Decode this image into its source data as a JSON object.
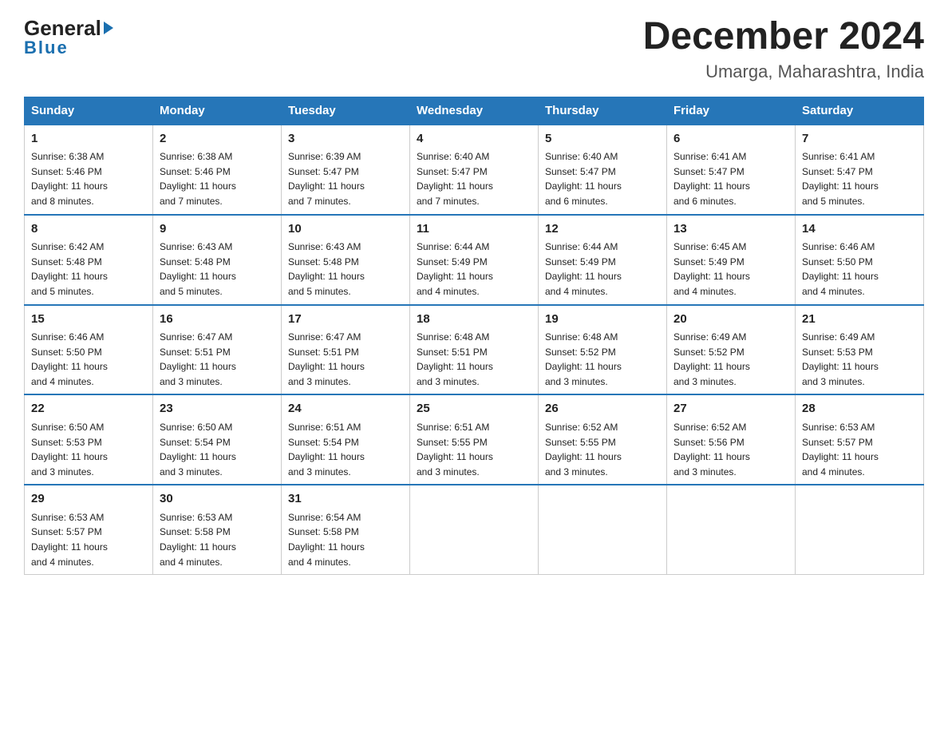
{
  "header": {
    "logo_general": "General",
    "logo_blue": "Blue",
    "month_year": "December 2024",
    "location": "Umarga, Maharashtra, India"
  },
  "weekdays": [
    "Sunday",
    "Monday",
    "Tuesday",
    "Wednesday",
    "Thursday",
    "Friday",
    "Saturday"
  ],
  "weeks": [
    [
      {
        "day": "1",
        "sunrise": "6:38 AM",
        "sunset": "5:46 PM",
        "daylight": "11 hours and 8 minutes."
      },
      {
        "day": "2",
        "sunrise": "6:38 AM",
        "sunset": "5:46 PM",
        "daylight": "11 hours and 7 minutes."
      },
      {
        "day": "3",
        "sunrise": "6:39 AM",
        "sunset": "5:47 PM",
        "daylight": "11 hours and 7 minutes."
      },
      {
        "day": "4",
        "sunrise": "6:40 AM",
        "sunset": "5:47 PM",
        "daylight": "11 hours and 7 minutes."
      },
      {
        "day": "5",
        "sunrise": "6:40 AM",
        "sunset": "5:47 PM",
        "daylight": "11 hours and 6 minutes."
      },
      {
        "day": "6",
        "sunrise": "6:41 AM",
        "sunset": "5:47 PM",
        "daylight": "11 hours and 6 minutes."
      },
      {
        "day": "7",
        "sunrise": "6:41 AM",
        "sunset": "5:47 PM",
        "daylight": "11 hours and 5 minutes."
      }
    ],
    [
      {
        "day": "8",
        "sunrise": "6:42 AM",
        "sunset": "5:48 PM",
        "daylight": "11 hours and 5 minutes."
      },
      {
        "day": "9",
        "sunrise": "6:43 AM",
        "sunset": "5:48 PM",
        "daylight": "11 hours and 5 minutes."
      },
      {
        "day": "10",
        "sunrise": "6:43 AM",
        "sunset": "5:48 PM",
        "daylight": "11 hours and 5 minutes."
      },
      {
        "day": "11",
        "sunrise": "6:44 AM",
        "sunset": "5:49 PM",
        "daylight": "11 hours and 4 minutes."
      },
      {
        "day": "12",
        "sunrise": "6:44 AM",
        "sunset": "5:49 PM",
        "daylight": "11 hours and 4 minutes."
      },
      {
        "day": "13",
        "sunrise": "6:45 AM",
        "sunset": "5:49 PM",
        "daylight": "11 hours and 4 minutes."
      },
      {
        "day": "14",
        "sunrise": "6:46 AM",
        "sunset": "5:50 PM",
        "daylight": "11 hours and 4 minutes."
      }
    ],
    [
      {
        "day": "15",
        "sunrise": "6:46 AM",
        "sunset": "5:50 PM",
        "daylight": "11 hours and 4 minutes."
      },
      {
        "day": "16",
        "sunrise": "6:47 AM",
        "sunset": "5:51 PM",
        "daylight": "11 hours and 3 minutes."
      },
      {
        "day": "17",
        "sunrise": "6:47 AM",
        "sunset": "5:51 PM",
        "daylight": "11 hours and 3 minutes."
      },
      {
        "day": "18",
        "sunrise": "6:48 AM",
        "sunset": "5:51 PM",
        "daylight": "11 hours and 3 minutes."
      },
      {
        "day": "19",
        "sunrise": "6:48 AM",
        "sunset": "5:52 PM",
        "daylight": "11 hours and 3 minutes."
      },
      {
        "day": "20",
        "sunrise": "6:49 AM",
        "sunset": "5:52 PM",
        "daylight": "11 hours and 3 minutes."
      },
      {
        "day": "21",
        "sunrise": "6:49 AM",
        "sunset": "5:53 PM",
        "daylight": "11 hours and 3 minutes."
      }
    ],
    [
      {
        "day": "22",
        "sunrise": "6:50 AM",
        "sunset": "5:53 PM",
        "daylight": "11 hours and 3 minutes."
      },
      {
        "day": "23",
        "sunrise": "6:50 AM",
        "sunset": "5:54 PM",
        "daylight": "11 hours and 3 minutes."
      },
      {
        "day": "24",
        "sunrise": "6:51 AM",
        "sunset": "5:54 PM",
        "daylight": "11 hours and 3 minutes."
      },
      {
        "day": "25",
        "sunrise": "6:51 AM",
        "sunset": "5:55 PM",
        "daylight": "11 hours and 3 minutes."
      },
      {
        "day": "26",
        "sunrise": "6:52 AM",
        "sunset": "5:55 PM",
        "daylight": "11 hours and 3 minutes."
      },
      {
        "day": "27",
        "sunrise": "6:52 AM",
        "sunset": "5:56 PM",
        "daylight": "11 hours and 3 minutes."
      },
      {
        "day": "28",
        "sunrise": "6:53 AM",
        "sunset": "5:57 PM",
        "daylight": "11 hours and 4 minutes."
      }
    ],
    [
      {
        "day": "29",
        "sunrise": "6:53 AM",
        "sunset": "5:57 PM",
        "daylight": "11 hours and 4 minutes."
      },
      {
        "day": "30",
        "sunrise": "6:53 AM",
        "sunset": "5:58 PM",
        "daylight": "11 hours and 4 minutes."
      },
      {
        "day": "31",
        "sunrise": "6:54 AM",
        "sunset": "5:58 PM",
        "daylight": "11 hours and 4 minutes."
      },
      null,
      null,
      null,
      null
    ]
  ],
  "labels": {
    "sunrise": "Sunrise:",
    "sunset": "Sunset:",
    "daylight": "Daylight:"
  }
}
